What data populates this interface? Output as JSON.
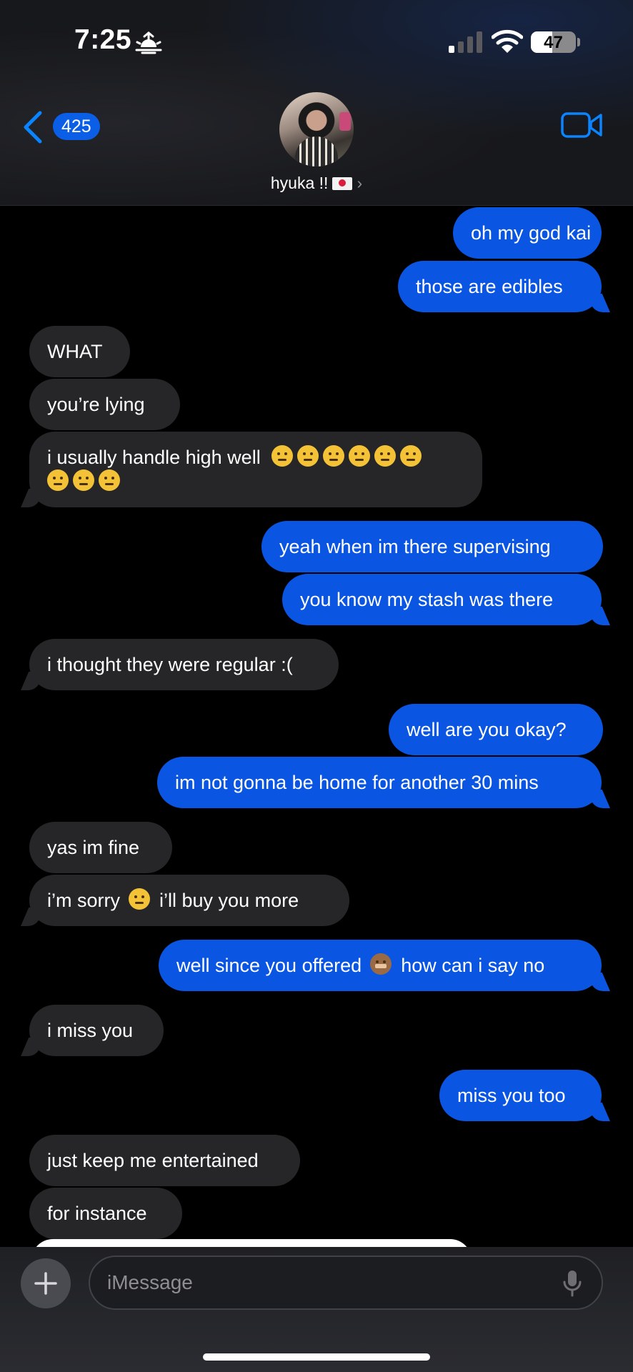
{
  "status_bar": {
    "time": "7:25",
    "battery_level": "47",
    "battery_fraction": 0.47
  },
  "header": {
    "back_badge_count": "425",
    "contact_name": "hyuka !!",
    "contact_chevron": "›",
    "icons": {
      "back": "chevron-left-icon",
      "video": "video-camera-icon",
      "flag": "flag-emoji-icon"
    },
    "accent_color": "#0a84ff"
  },
  "colors": {
    "sent_bubble": "#0a56e2",
    "received_bubble": "#262628",
    "background": "#000000"
  },
  "messages": [
    {
      "dir": "sent",
      "text": "oh my god kai"
    },
    {
      "dir": "sent",
      "text": "those are edibles"
    },
    {
      "dir": "recv",
      "text": "WHAT"
    },
    {
      "dir": "recv",
      "text": "you’re lying"
    },
    {
      "dir": "recv",
      "text": "i usually handle high well",
      "emoji_line1": 6,
      "emoji_line2": 3
    },
    {
      "dir": "sent",
      "text": "yeah when im there supervising"
    },
    {
      "dir": "sent",
      "text": "you know my stash was there"
    },
    {
      "dir": "recv",
      "text": "i thought they were regular :("
    },
    {
      "dir": "sent",
      "text": "well are you okay?"
    },
    {
      "dir": "sent",
      "text": "im not gonna be home for another 30 mins"
    },
    {
      "dir": "recv",
      "text": "yas im fine"
    },
    {
      "dir": "recv",
      "text_before": "i’m sorry",
      "text_after": "i’ll buy you more"
    },
    {
      "dir": "sent",
      "text_before": "well since you offered",
      "text_after": "how can i say no"
    },
    {
      "dir": "recv",
      "text": "i miss you"
    },
    {
      "dir": "sent",
      "text": "miss you too"
    },
    {
      "dir": "recv",
      "text": "just keep me entertained"
    },
    {
      "dir": "recv",
      "text": "for instance"
    }
  ],
  "composer": {
    "placeholder": "iMessage",
    "icons": {
      "add": "plus-icon",
      "dictation": "microphone-icon"
    }
  }
}
